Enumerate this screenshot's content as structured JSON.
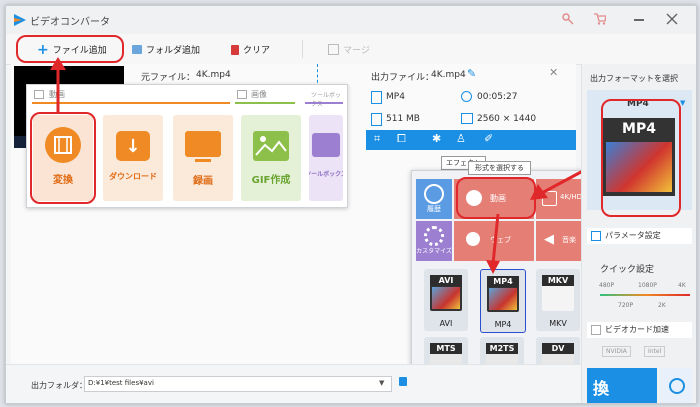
{
  "titlebar": {
    "title": "ビデオコンバータ"
  },
  "toolbar": {
    "add_file": "ファイル追加",
    "add_folder": "フォルダ追加",
    "clear": "クリア",
    "merge": "マージ"
  },
  "file": {
    "source_label": "元ファイル：",
    "source_name": "4K.mp4",
    "output_label": "出力ファイル：",
    "output_name": "4K.mp4",
    "format": "MP4",
    "duration": "00:05:27",
    "size": "511 MB",
    "resolution": "2560 × 1440"
  },
  "left_panel": {
    "sections": {
      "video": "動画",
      "image": "画像",
      "toolbox": "ツールボックス"
    },
    "tiles": [
      {
        "label": "変換"
      },
      {
        "label": "ダウンロード"
      },
      {
        "label": "録画"
      },
      {
        "label": "GIF作成"
      },
      {
        "label": "ツールボックス"
      }
    ]
  },
  "tooltip": {
    "effect": "エフェクト"
  },
  "format_popup": {
    "hint": "形式を選択する",
    "categories": [
      {
        "label": "履歴"
      },
      {
        "label": "動画"
      },
      {
        "label": "4K/HD"
      },
      {
        "label": "カスタマイズ"
      },
      {
        "label": "ウェブ"
      },
      {
        "label": "音楽"
      }
    ],
    "formats": [
      "AVI",
      "MP4",
      "MKV",
      "MTS",
      "M2TS",
      "DV"
    ]
  },
  "right_panel": {
    "title": "出力フォーマットを選択",
    "selected_format": "MP4",
    "param_settings": "パラメータ設定",
    "quick_settings": "クイック設定",
    "res_labels_top": [
      "480P",
      "1080P",
      "4K"
    ],
    "res_labels_bottom": [
      "720P",
      "2K"
    ],
    "accel": "ビデオカード加速",
    "accel_badges": [
      "NVIDIA",
      "Intel"
    ],
    "run_label": "換"
  },
  "output_folder": {
    "label": "出力フォルダ：",
    "path": "D:¥1¥test files¥avi"
  },
  "colors": {
    "accent": "#1a8fe3",
    "highlight": "#e0282b",
    "orange": "#f08a24"
  }
}
